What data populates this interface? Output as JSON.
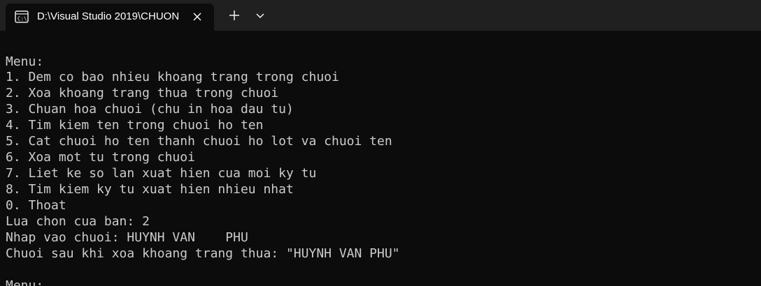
{
  "window": {
    "tab_title": "D:\\Visual Studio 2019\\CHUON",
    "tab_icon": "terminal-icon"
  },
  "colors": {
    "titlebar_bg": "#202020",
    "console_bg": "#0c0c0c",
    "console_text": "#cccccc"
  },
  "console": {
    "lines": [
      "",
      "Menu:",
      "1. Dem co bao nhieu khoang trang trong chuoi",
      "2. Xoa khoang trang thua trong chuoi",
      "3. Chuan hoa chuoi (chu in hoa dau tu)",
      "4. Tim kiem ten trong chuoi ho ten",
      "5. Cat chuoi ho ten thanh chuoi ho lot va chuoi ten",
      "6. Xoa mot tu trong chuoi",
      "7. Liet ke so lan xuat hien cua moi ky tu",
      "8. Tim kiem ky tu xuat hien nhieu nhat",
      "0. Thoat",
      "Lua chon cua ban: 2",
      "Nhap vao chuoi: HUYNH VAN    PHU",
      "Chuoi sau khi xoa khoang trang thua: \"HUYNH VAN PHU\"",
      "",
      "Menu:"
    ]
  }
}
